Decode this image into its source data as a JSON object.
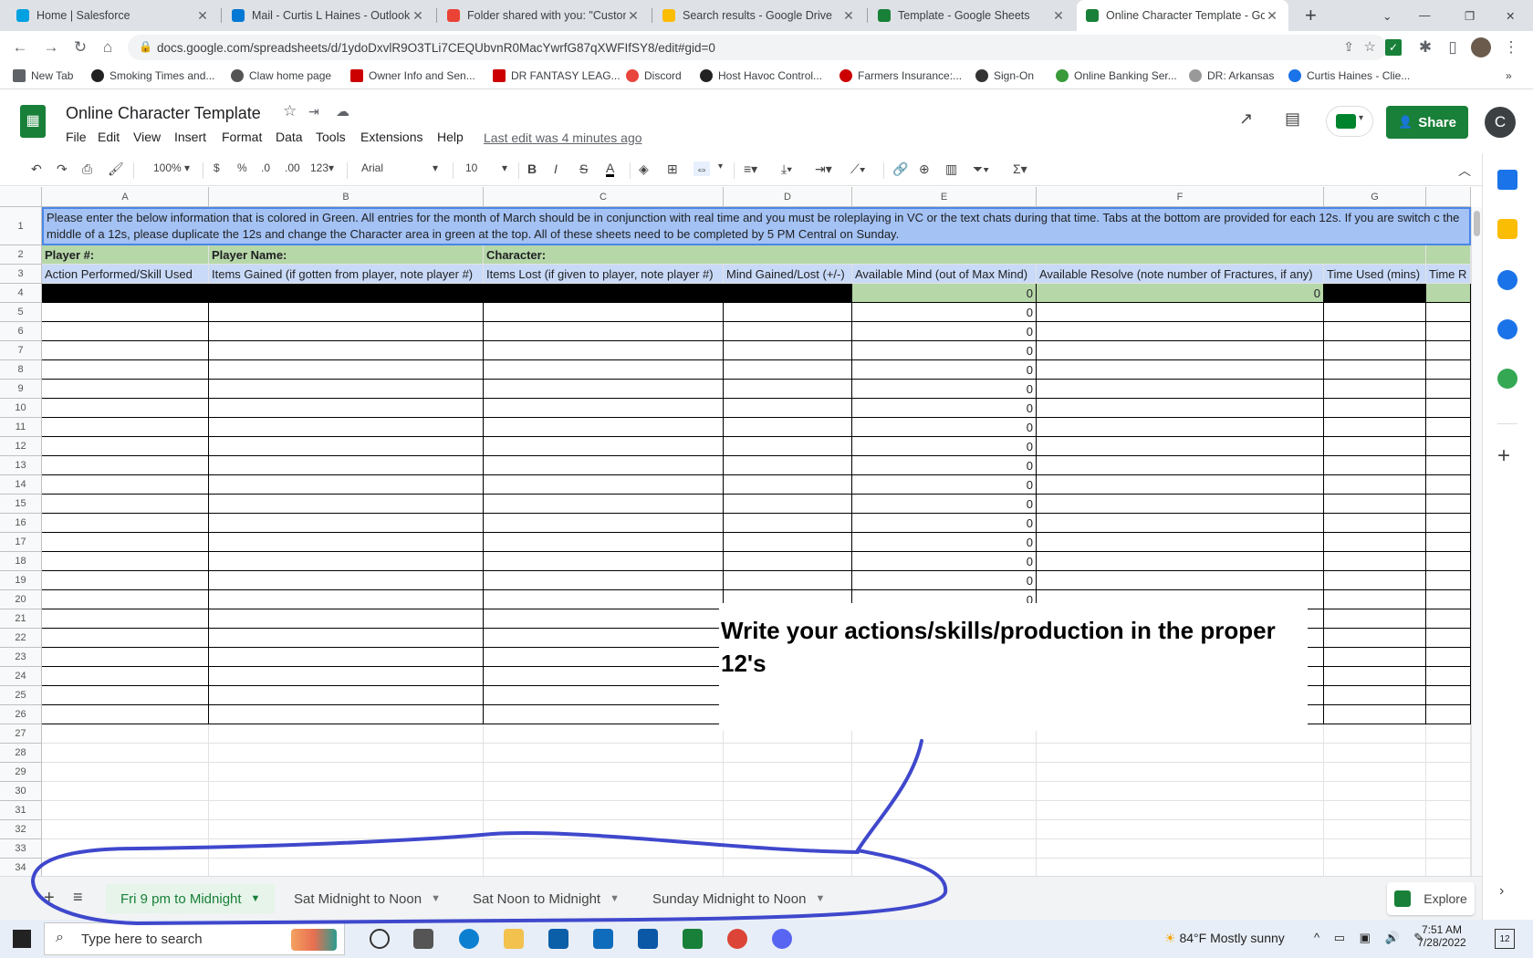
{
  "browser": {
    "tabs": [
      {
        "title": "Home | Salesforce",
        "color": "#00a1e0"
      },
      {
        "title": "Mail - Curtis L Haines - Outlook",
        "color": "#0078d4"
      },
      {
        "title": "Folder shared with you: \"Custom",
        "color": "#ea4335"
      },
      {
        "title": "Search results - Google Drive",
        "color": "#fbbc04"
      },
      {
        "title": "Template - Google Sheets",
        "color": "#188038"
      },
      {
        "title": "Online Character Template - Go",
        "color": "#188038",
        "active": true
      }
    ],
    "url": "docs.google.com/spreadsheets/d/1ydoDxvlR9O3TLi7CEQUbvnR0MacYwrfG87qXWFIfSY8/edit#gid=0",
    "bookmarks": [
      "New Tab",
      "Smoking Times and...",
      "Claw home page",
      "Owner Info and Sen...",
      "DR FANTASY LEAG...",
      "Discord",
      "Host Havoc Control...",
      "Farmers Insurance:...",
      "Sign-On",
      "Online Banking Ser...",
      "DR: Arkansas",
      "Curtis Haines - Clie..."
    ]
  },
  "sheets": {
    "title": "Online Character Template",
    "menus": [
      "File",
      "Edit",
      "View",
      "Insert",
      "Format",
      "Data",
      "Tools",
      "Extensions",
      "Help"
    ],
    "last_edit": "Last edit was 4 minutes ago",
    "share_label": "Share",
    "avatar_letter": "C",
    "toolbar": {
      "zoom": "100%",
      "currency": "$",
      "percent": "%",
      "dec_decrease": ".0",
      "dec_increase": ".00",
      "more_formats": "123",
      "font": "Arial",
      "font_size": "10"
    }
  },
  "grid": {
    "columns": [
      "A",
      "B",
      "C",
      "D",
      "E",
      "F",
      "G"
    ],
    "rows": [
      "1",
      "2",
      "3",
      "4",
      "5",
      "6",
      "7",
      "8",
      "9",
      "10",
      "11",
      "12",
      "13",
      "14",
      "15",
      "16",
      "17",
      "18",
      "19",
      "20",
      "21",
      "22",
      "23",
      "24",
      "25",
      "26",
      "27",
      "28",
      "29",
      "30",
      "31",
      "32",
      "33",
      "34"
    ],
    "banner": "Please enter the below information that is colored in Green. All entries for the month of March should be in conjunction with real time and you must be roleplaying in VC or the text chats during that time. Tabs at the bottom are provided for each 12s. If you are switch c the middle of a 12s, please duplicate the 12s and change the Character area in green at the top. All of these sheets need to be completed by 5 PM Central on Sunday.",
    "row2": {
      "player_num": "Player #:",
      "player_name": "Player Name:",
      "character": "Character:"
    },
    "headers": [
      "Action Performed/Skill Used",
      "Items Gained (if gotten from player, note player #)",
      "Items Lost (if given to player, note player #)",
      "Mind Gained/Lost (+/-)",
      "Available Mind (out of Max Mind)",
      "Available Resolve (note number of Fractures, if any)",
      "Time Used (mins)",
      "Time R"
    ],
    "e_values": [
      "0",
      "0",
      "0",
      "0",
      "0",
      "0",
      "0",
      "0",
      "0",
      "0",
      "0",
      "0",
      "0",
      "0",
      "0",
      "0",
      "0"
    ],
    "f4_value": "0",
    "textbox": "Write your actions/skills/production in the proper 12's"
  },
  "sheet_tabs": [
    "Fri 9 pm to Midnight",
    "Sat Midnight to Noon",
    "Sat Noon to Midnight",
    "Sunday Midnight to Noon"
  ],
  "explore_label": "Explore",
  "taskbar": {
    "search_placeholder": "Type here to search",
    "weather": "84°F  Mostly sunny",
    "time": "7:51 AM",
    "date": "7/28/2022",
    "notifications": "12"
  },
  "colors": {
    "green_fill": "#b6d7a8",
    "blue_banner": "#a4c2f4",
    "blue_header": "#c9daf8",
    "annotation": "#3f48cc",
    "share_green": "#188038"
  }
}
